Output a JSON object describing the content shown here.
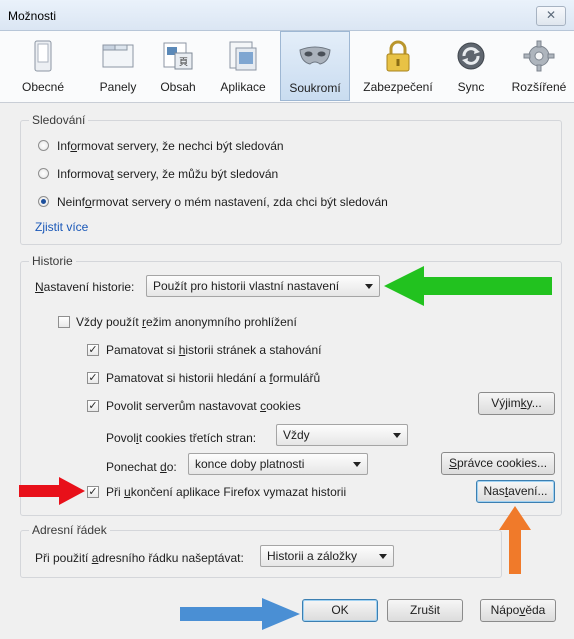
{
  "window": {
    "title": "Možnosti",
    "close_glyph": "✕"
  },
  "tabs": [
    {
      "label": "Obecné",
      "icon": "switch-icon"
    },
    {
      "label": "Panely",
      "icon": "tabs-icon"
    },
    {
      "label": "Obsah",
      "icon": "content-icon"
    },
    {
      "label": "Aplikace",
      "icon": "applications-icon"
    },
    {
      "label": "Soukromí",
      "icon": "mask-icon"
    },
    {
      "label": "Zabezpečení",
      "icon": "padlock-icon"
    },
    {
      "label": "Sync",
      "icon": "sync-icon"
    },
    {
      "label": "Rozšířené",
      "icon": "gear-icon"
    }
  ],
  "active_tab": "Soukromí",
  "tracking": {
    "title": "Sledování",
    "options": [
      {
        "pre": "Inf",
        "u": "o",
        "post": "rmovat servery, že nechci být sledován",
        "selected": false
      },
      {
        "pre": "Informova",
        "u": "t",
        "post": " servery, že můžu být sledován",
        "selected": false
      },
      {
        "pre": "Neinf",
        "u": "o",
        "post": "rmovat servery o mém nastavení, zda chci být sledován",
        "selected": true
      }
    ],
    "more_link": "Zjistit více"
  },
  "history": {
    "title": "Historie",
    "setting_label_pre": "",
    "setting_label_u": "N",
    "setting_label_post": "astavení historie:",
    "setting_value": "Použít pro historii vlastní nastavení",
    "private": {
      "pre": "Vždy použít ",
      "u": "r",
      "post": "ežim anonymního prohlížení",
      "checked": false
    },
    "remember_browse": {
      "pre": "Pamatovat si ",
      "u": "h",
      "post": "istorii stránek a stahování",
      "checked": true
    },
    "remember_search": {
      "pre": "Pamatovat si historii hledání a ",
      "u": "f",
      "post": "ormulářů",
      "checked": true
    },
    "cookies": {
      "pre": "Povolit serverům nastavovat ",
      "u": "c",
      "post": "ookies",
      "checked": true
    },
    "exceptions_pre": "Výjim",
    "exceptions_u": "k",
    "exceptions_post": "y...",
    "third_party_pre": "Povol",
    "third_party_u": "i",
    "third_party_post": "t cookies třetích stran:",
    "third_party_value": "Vždy",
    "keep_pre": "Ponechat ",
    "keep_u": "d",
    "keep_post": "o:",
    "keep_value": "konce doby platnosti",
    "manage_pre": "",
    "manage_u": "S",
    "manage_post": "právce cookies...",
    "clear_on_close": {
      "pre": "Při ",
      "u": "u",
      "post": "končení aplikace Firefox vymazat historii",
      "checked": true
    },
    "settings_pre": "Nas",
    "settings_u": "t",
    "settings_post": "avení..."
  },
  "address_bar": {
    "title": "Adresní řádek",
    "label_pre": "Při použití ",
    "label_u": "a",
    "label_post": "dresního řádku našeptávat:",
    "value": "Historii a záložky"
  },
  "buttons": {
    "ok": "OK",
    "cancel": "Zrušit",
    "help_pre": "Nápo",
    "help_u": "v",
    "help_post": "ěda"
  },
  "annotation_colors": {
    "green": "#22c21f",
    "red": "#e8101a",
    "orange": "#f07a2a",
    "blue": "#4a8fd4"
  },
  "check_glyph": "✓"
}
